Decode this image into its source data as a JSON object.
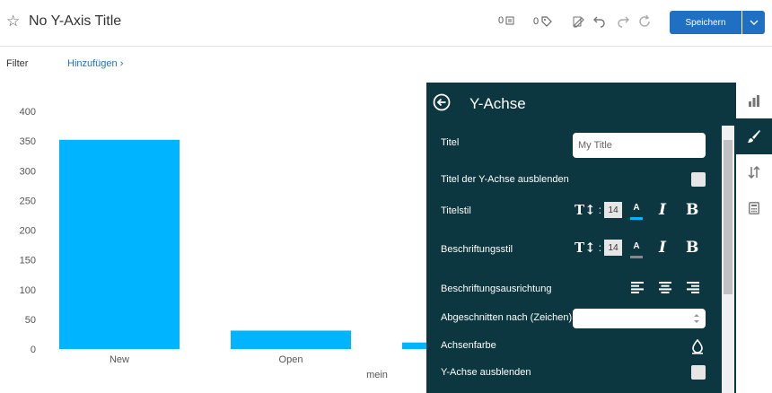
{
  "header": {
    "title": "No Y-Axis Title",
    "comment_count": "0",
    "tag_count": "0",
    "save_label": "Speichern"
  },
  "filter": {
    "label": "Filter",
    "add_label": "Hinzufügen ›"
  },
  "chart_data": {
    "type": "bar",
    "categories": [
      "New",
      "Open",
      "mein"
    ],
    "values": [
      352,
      31,
      11
    ],
    "title": "",
    "xlabel": "",
    "ylabel": "",
    "ylim": [
      0,
      400
    ],
    "yticks": [
      0,
      50,
      100,
      150,
      200,
      250,
      300,
      350,
      400
    ],
    "grid": false,
    "bar_color": "#00b4ff"
  },
  "panel": {
    "title": "Y-Achse",
    "rows": {
      "titel": "Titel",
      "titel_value": "My Title",
      "hide_title": "Titel der Y-Achse ausblenden",
      "title_style": "Titelstil",
      "title_font_size": "14",
      "label_style": "Beschriftungsstil",
      "label_font_size": "14",
      "label_alignment": "Beschriftungsausrichtung",
      "truncate": "Abgeschnitten nach (Zeichen)",
      "axis_color": "Achsenfarbe",
      "hide_axis": "Y-Achse ausblenden"
    },
    "icons": {
      "font_size": "T↕",
      "color": "A",
      "italic": "I",
      "bold": "B",
      "colon": ":"
    },
    "colors": {
      "background": "#0c3640",
      "title_color_bar": "#00b4ff",
      "label_color_bar": "#888888"
    }
  },
  "colors": {
    "accent": "#1f6fc2"
  }
}
